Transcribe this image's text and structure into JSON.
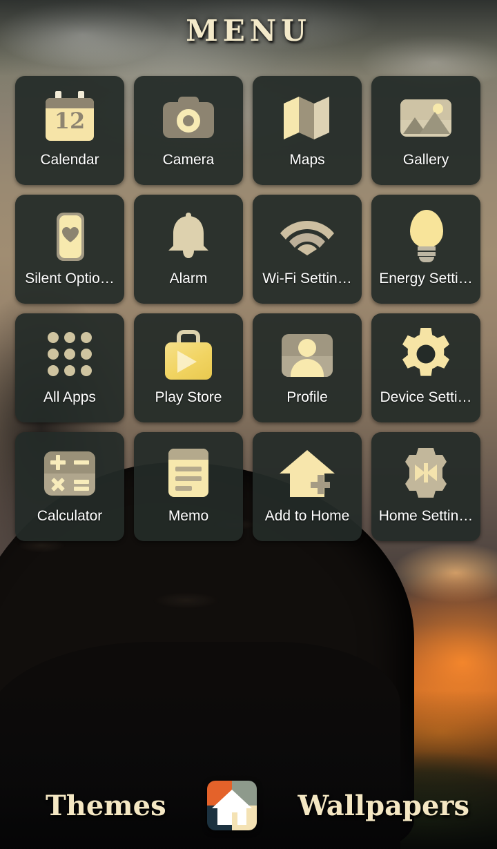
{
  "header": {
    "title": "MENU"
  },
  "grid": {
    "apps": [
      {
        "label": "Calendar",
        "icon": "calendar-icon",
        "date_number": "12"
      },
      {
        "label": "Camera",
        "icon": "camera-icon"
      },
      {
        "label": "Maps",
        "icon": "map-icon"
      },
      {
        "label": "Gallery",
        "icon": "gallery-image-icon"
      },
      {
        "label": "Silent Optio…",
        "icon": "silent-options-phone-heart-icon"
      },
      {
        "label": "Alarm",
        "icon": "bell-icon"
      },
      {
        "label": "Wi-Fi Settin…",
        "icon": "wifi-icon"
      },
      {
        "label": "Energy Setti…",
        "icon": "lightbulb-icon"
      },
      {
        "label": "All Apps",
        "icon": "app-drawer-grid-icon"
      },
      {
        "label": "Play Store",
        "icon": "play-store-bag-icon"
      },
      {
        "label": "Profile",
        "icon": "profile-person-icon"
      },
      {
        "label": "Device Setti…",
        "icon": "gear-icon"
      },
      {
        "label": "Calculator",
        "icon": "calculator-icon"
      },
      {
        "label": "Memo",
        "icon": "memo-note-icon"
      },
      {
        "label": "Add to Home",
        "icon": "add-to-home-house-plus-icon"
      },
      {
        "label": "Home Settin…",
        "icon": "home-settings-gear-icon"
      }
    ]
  },
  "bottom_bar": {
    "themes_label": "Themes",
    "wallpapers_label": "Wallpapers",
    "home_icon": "home-button-icon"
  },
  "colors": {
    "tile_background": "#242b28",
    "label_text": "#ffffff",
    "title_text": "#f3e9c9",
    "accent_cream": "#f7e9ae",
    "accent_taupe": "#8e8470",
    "accent_yellow": "#f3d86e",
    "home_orange": "#e4622a",
    "home_sage": "#8e9a8c",
    "home_navy": "#1c3240",
    "home_cream": "#f4e2b4"
  }
}
